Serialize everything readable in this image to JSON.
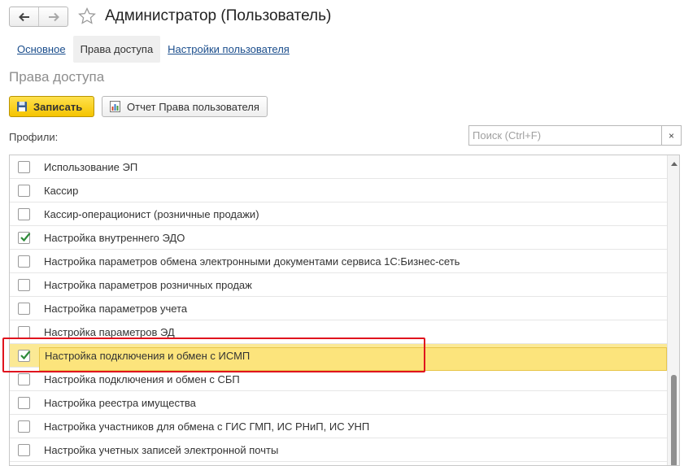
{
  "window": {
    "title": "Администратор (Пользователь)"
  },
  "tabs": [
    {
      "label": "Основное",
      "active": false
    },
    {
      "label": "Права доступа",
      "active": true
    },
    {
      "label": "Настройки пользователя",
      "active": false
    }
  ],
  "section": {
    "title": "Права доступа"
  },
  "toolbar": {
    "save_label": "Записать",
    "report_label": "Отчет Права пользователя"
  },
  "profiles": {
    "label": "Профили:",
    "search_placeholder": "Поиск (Ctrl+F)",
    "clear_symbol": "×",
    "items": [
      {
        "label": "Использование ЭП",
        "checked": false
      },
      {
        "label": "Кассир",
        "checked": false
      },
      {
        "label": "Кассир-операционист (розничные продажи)",
        "checked": false
      },
      {
        "label": "Настройка внутреннего ЭДО",
        "checked": true
      },
      {
        "label": "Настройка параметров обмена электронными документами сервиса 1С:Бизнес-сеть",
        "checked": false
      },
      {
        "label": "Настройка параметров розничных продаж",
        "checked": false
      },
      {
        "label": "Настройка параметров учета",
        "checked": false
      },
      {
        "label": "Настройка параметров ЭД",
        "checked": false
      },
      {
        "label": "Настройка подключения и обмен с ИСМП",
        "checked": true,
        "selected": true
      },
      {
        "label": "Настройка подключения и обмен с СБП",
        "checked": false
      },
      {
        "label": "Настройка реестра имущества",
        "checked": false
      },
      {
        "label": "Настройка участников для обмена с ГИС ГМП, ИС РНиП, ИС УНП",
        "checked": false
      },
      {
        "label": "Настройка учетных записей электронной почты",
        "checked": false
      }
    ]
  },
  "icons": {
    "back": "arrow-left-icon",
    "forward": "arrow-right-icon",
    "favorite": "star-icon",
    "save": "floppy-disk-icon",
    "report": "report-chart-icon",
    "check": "checkmark-icon"
  },
  "colors": {
    "accent_yellow": "#f5c400",
    "selected_row": "#fce47c",
    "link": "#1a4d8c",
    "check_green": "#2e8b3a",
    "highlight_red": "#e0141e"
  }
}
